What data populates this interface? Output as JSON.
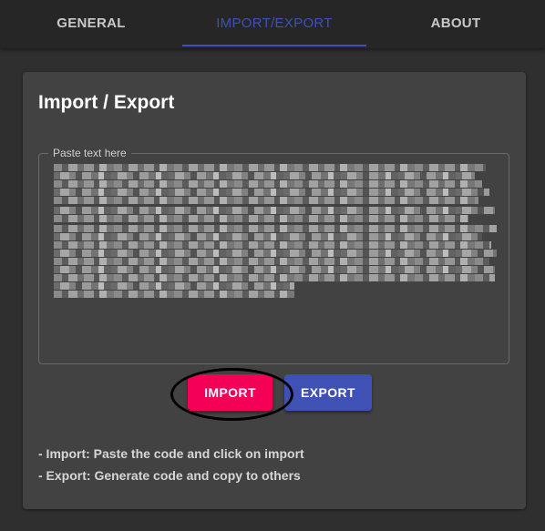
{
  "tabs": {
    "items": [
      {
        "label": "GENERAL"
      },
      {
        "label": "IMPORT/EXPORT"
      },
      {
        "label": "ABOUT"
      }
    ],
    "active_index": 1
  },
  "card": {
    "title": "Import / Export",
    "textarea": {
      "label": "Paste text here",
      "value_visibility": "redacted"
    },
    "buttons": {
      "import_label": "IMPORT",
      "export_label": "EXPORT"
    },
    "help": [
      "- Import: Paste the code and click on import",
      "- Export: Generate code and copy to others"
    ]
  },
  "colors": {
    "accent_primary": "#3f51b5",
    "accent_secondary": "#f50057",
    "background": "#2f2f2f",
    "card": "#424242",
    "tabbar": "#262626"
  },
  "icons": {
    "annotation": "highlight-ellipse"
  }
}
